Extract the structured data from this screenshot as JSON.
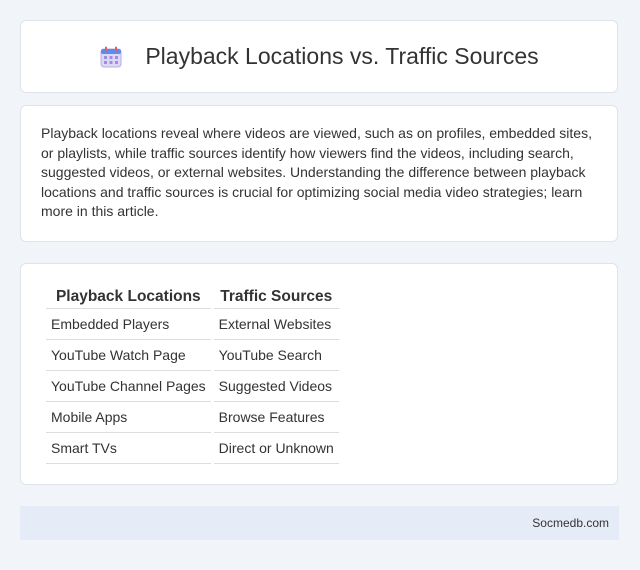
{
  "header": {
    "title": "Playback Locations vs. Traffic Sources",
    "icon": "calendar-icon"
  },
  "intro": {
    "text": "Playback locations reveal where videos are viewed, such as on profiles, embedded sites, or playlists, while traffic sources identify how viewers find the videos, including search, suggested videos, or external websites. Understanding the difference between playback locations and traffic sources is crucial for optimizing social media video strategies; learn more in this article."
  },
  "table": {
    "headers": [
      "Playback Locations",
      "Traffic Sources"
    ],
    "rows": [
      [
        "Embedded Players",
        "External Websites"
      ],
      [
        "YouTube Watch Page",
        "YouTube Search"
      ],
      [
        "YouTube Channel Pages",
        "Suggested Videos"
      ],
      [
        "Mobile Apps",
        "Browse Features"
      ],
      [
        "Smart TVs",
        "Direct or Unknown"
      ]
    ]
  },
  "footer": {
    "text": "Socmedb.com"
  },
  "colors": {
    "background": "#f1f4f9",
    "card": "#ffffff",
    "footer": "#e6ecf7",
    "icon_body": "#ded7f5",
    "icon_accent": "#5b8ee8"
  }
}
